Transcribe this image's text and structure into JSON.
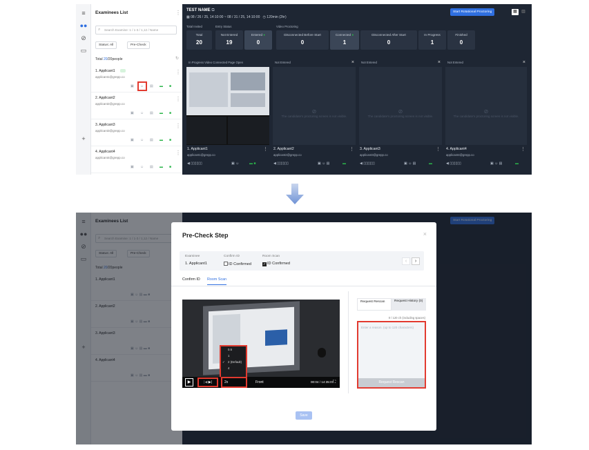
{
  "sidebar": {
    "title": "Examinees List",
    "search_placeholder": "Search Examine: 1 / 1-3 / 1,12 / Name",
    "status_filter": "Status: All",
    "precheck_filter": "Pre-Check",
    "total_prefix": "Total ",
    "total_count": "20",
    "total_suffix": "/20people",
    "applicants": [
      {
        "name": "1. Applicant1",
        "email": "applicant1@grepp.co"
      },
      {
        "name": "2. Applicant2",
        "email": "applicant2@grepp.co"
      },
      {
        "name": "3. Applicant3",
        "email": "applicant3@grepp.co"
      },
      {
        "name": "4. Applicant4",
        "email": "applicant4@grepp.co"
      }
    ]
  },
  "exam": {
    "title": "TEST NAME",
    "date_range": "08 / 26 / 25, 14:10:00 ~ 08 / 31 / 25, 14:10:00",
    "duration": "120min (2hr)",
    "start_button": "Start Rotational Proctoring"
  },
  "stat_groups": [
    "Total Invited",
    "Entry Status",
    "Video Proctoring"
  ],
  "stats": [
    {
      "label": "Total",
      "value": "20"
    },
    {
      "label": "Not Entered",
      "value": "19"
    },
    {
      "label": "Entered",
      "value": "0"
    },
    {
      "label": "Disconnected Before Start",
      "value": "0"
    },
    {
      "label": "Connected",
      "value": "1"
    },
    {
      "label": "Disconnected After Start",
      "value": "0"
    },
    {
      "label": "In Progress",
      "value": "1"
    },
    {
      "label": "Finished",
      "value": "0"
    }
  ],
  "cards": [
    {
      "status": "In Progress   Video Connected   Page Open",
      "name": "1. Applicant1",
      "email": "applicant1@grepp.co"
    },
    {
      "status": "Not Entered",
      "name": "2. Applicant2",
      "email": "applicant2@grepp.co"
    },
    {
      "status": "Not Entered",
      "name": "3. Applicant3",
      "email": "applicant3@grepp.co"
    },
    {
      "status": "Not Entered",
      "name": "4. Applicant4",
      "email": "applicant4@grepp.co"
    }
  ],
  "card_placeholder": "The candidate's proctoring screen is not visible.",
  "modal": {
    "title": "Pre-Check Step",
    "examinee_label": "Examinee",
    "examinee_value": "1. Applicant1",
    "confirm_id_label": "Confirm ID",
    "confirm_id_value": "ID Confirmed",
    "room_scan_label": "Room Scan",
    "room_scan_value": "ID Confirmed",
    "tabs": [
      "Confirm ID",
      "Room Scan"
    ],
    "speed_options": [
      "0.5",
      "1",
      "2 (Default)",
      "4"
    ],
    "speed_current": "2x",
    "camera_label": "Front",
    "time": "00:04 / 14:35:07",
    "request_rescan_tab": "Request Rescan",
    "request_history_tab": "Request History (0)",
    "char_count": "0 / 120 ch (including spaces)",
    "reason_placeholder": "Enter a reason. (up to 120 characters)",
    "request_rescan_button": "Request Rescan",
    "save_button": "Save"
  }
}
